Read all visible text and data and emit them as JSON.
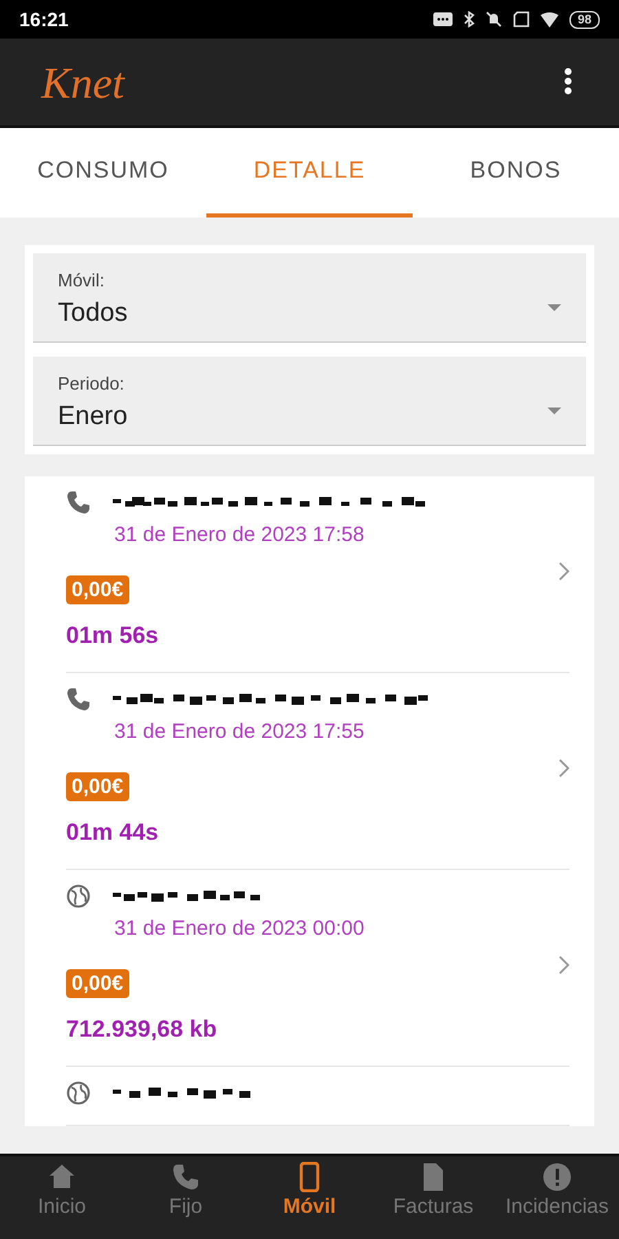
{
  "status_bar": {
    "time": "16:21",
    "battery": "98"
  },
  "app_bar": {
    "logo": "Knet"
  },
  "tabs": [
    {
      "label": "CONSUMO",
      "selected": false
    },
    {
      "label": "DETALLE",
      "selected": true
    },
    {
      "label": "BONOS",
      "selected": false
    }
  ],
  "filters": [
    {
      "label": "Móvil:",
      "value": "Todos"
    },
    {
      "label": "Periodo:",
      "value": "Enero"
    }
  ],
  "records": [
    {
      "kind": "call",
      "date": "31 de Enero de 2023 17:58",
      "price": "0,00€",
      "amount": "01m 56s"
    },
    {
      "kind": "call",
      "date": "31 de Enero de 2023 17:55",
      "price": "0,00€",
      "amount": "01m 44s"
    },
    {
      "kind": "data",
      "date": "31 de Enero de 2023 00:00",
      "price": "0,00€",
      "amount": "712.939,68 kb"
    },
    {
      "kind": "data"
    }
  ],
  "bottom_nav": [
    {
      "label": "Inicio",
      "kind": "home",
      "selected": false
    },
    {
      "label": "Fijo",
      "kind": "phone",
      "selected": false
    },
    {
      "label": "Móvil",
      "kind": "mobile",
      "selected": true
    },
    {
      "label": "Facturas",
      "kind": "file",
      "selected": false
    },
    {
      "label": "Incidencias",
      "kind": "alert",
      "selected": false
    }
  ]
}
